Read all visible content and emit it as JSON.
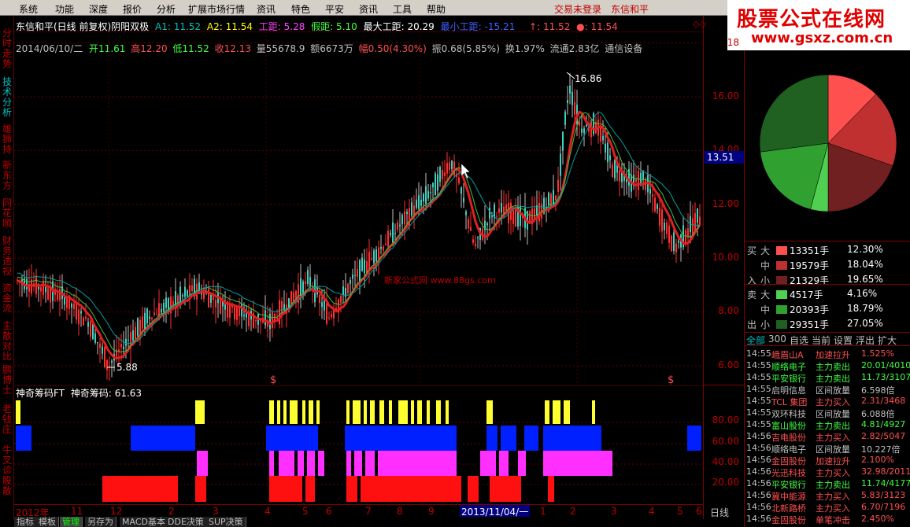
{
  "menu": {
    "items": [
      "系统",
      "功能",
      "深度",
      "报价",
      "分析",
      "扩展市场行情",
      "资讯",
      "特色",
      "平安",
      "资讯",
      "工具",
      "帮助"
    ],
    "login_status": "交易未登录",
    "stock_name": "东信和平"
  },
  "watermark": {
    "title": "股票公式在线网",
    "url": "www.gsxz.com.cn"
  },
  "left_tabs": [
    {
      "label": "分时走势",
      "active": false
    },
    {
      "label": "技术分析",
      "active": true
    },
    {
      "label": "雄狮持",
      "active": false
    },
    {
      "label": "新东方",
      "active": false
    },
    {
      "label": "同花顺",
      "active": false
    },
    {
      "label": "财务透视",
      "active": false
    },
    {
      "label": "资金流",
      "active": false
    },
    {
      "label": "主散对比",
      "active": false
    },
    {
      "label": "鹏博士",
      "active": false
    },
    {
      "label": "老钱庄",
      "active": false
    },
    {
      "label": "牛叉诊股",
      "active": false
    },
    {
      "label": "散",
      "active": false
    }
  ],
  "indicator_header": {
    "title": "东信和平(日线 前复权)阴阳双极",
    "a1": "A1: 11.52",
    "a2": "A2: 11.54",
    "gongju": "工距: 5.28",
    "jiaju": "假距: 5.10",
    "maxgongju": "最大工距: 20.29",
    "mingongju": "最小工距: -15.21",
    "v1": "↑: 11.52",
    "v2": "●: 11.54",
    "colors": {
      "a1": "#00c0c0",
      "gongju": "#ff40ff",
      "jiaju": "#40ff40",
      "min": "#4060ff",
      "white": "#ffffff"
    }
  },
  "ohlc_line": {
    "date": "2014/06/10/二",
    "open": "开11.61",
    "high": "高12.20",
    "low": "低11.52",
    "close": "收12.13",
    "volume": "量55678.9",
    "amount": "额6673万",
    "change": "幅0.50(4.30%)",
    "amplitude": "振0.68(5.85%)",
    "turnover": "换1.97%",
    "float": "流通2.83亿",
    "sector": "通信设备"
  },
  "main_chart": {
    "high_label": "16.86",
    "low_label": "5.88",
    "watermark": "新家公式网 www.88gs.com",
    "y_ticks": [
      "18",
      "16.00",
      "14.00",
      "12.00",
      "10.00",
      "8.00",
      "6.00"
    ],
    "current_price": "13.51"
  },
  "sub_chart": {
    "title": "神奇筹码FT",
    "value": "神奇筹码: 61.63",
    "y_ticks": [
      "80.00",
      "60.00",
      "40.00",
      "20.00"
    ]
  },
  "date_axis": {
    "labels": [
      "2012年",
      "11",
      "12",
      "2",
      "3",
      "4",
      "5",
      "6",
      "7",
      "8",
      "9",
      "10",
      "1",
      "2",
      "3",
      "4",
      "5",
      "6"
    ],
    "highlight": "2013/11/04/一",
    "period": "日线"
  },
  "bottom_tabs": [
    "指标",
    "模板",
    "管理",
    "另存为",
    "MACD基本",
    "DDE决策",
    "SUP决策"
  ],
  "capital_flow": {
    "buy_label": [
      "买",
      "入"
    ],
    "sell_label": [
      "卖",
      "出"
    ],
    "rows": [
      {
        "side": "买",
        "size": "大",
        "volume": "13351手",
        "pct": "12.30%",
        "color": "#ff5050"
      },
      {
        "side": "",
        "size": "中",
        "volume": "19579手",
        "pct": "18.04%",
        "color": "#c03030"
      },
      {
        "side": "入",
        "size": "小",
        "volume": "21329手",
        "pct": "19.65%",
        "color": "#702020"
      },
      {
        "side": "卖",
        "size": "大",
        "volume": "4517手",
        "pct": "4.16%",
        "color": "#50d050"
      },
      {
        "side": "",
        "size": "中",
        "volume": "20393手",
        "pct": "18.79%",
        "color": "#30a030"
      },
      {
        "side": "出",
        "size": "小",
        "volume": "29351手",
        "pct": "27.05%",
        "color": "#206020"
      }
    ]
  },
  "panel_tabs": [
    "全部",
    "300",
    "自选",
    "当前",
    "设置",
    "浮出",
    "扩大"
  ],
  "ticker": [
    {
      "time": "14:55",
      "name": "峨眉山A",
      "event": "加速拉升",
      "value": "1.525%",
      "color": "#ff5050"
    },
    {
      "time": "14:55",
      "name": "顺络电子",
      "event": "主力卖出",
      "value": "20.01/4010",
      "color": "#40ff40"
    },
    {
      "time": "14:55",
      "name": "平安银行",
      "event": "主力卖出",
      "value": "11.73/3107",
      "color": "#40ff40"
    },
    {
      "time": "14:55",
      "name": "启明信息",
      "event": "区间放量",
      "value": "6.598倍",
      "color": "#c0c0c0"
    },
    {
      "time": "14:55",
      "name": "TCL 集团",
      "event": "主力买入",
      "value": "2.31/3468",
      "color": "#ff5050"
    },
    {
      "time": "14:55",
      "name": "双环科技",
      "event": "区间放量",
      "value": "6.088倍",
      "color": "#c0c0c0"
    },
    {
      "time": "14:55",
      "name": "富山股份",
      "event": "主力卖出",
      "value": "4.81/4927",
      "color": "#40ff40"
    },
    {
      "time": "14:56",
      "name": "吉电股份",
      "event": "主力买入",
      "value": "2.82/5047",
      "color": "#ff5050"
    },
    {
      "time": "14:56",
      "name": "顺络电子",
      "event": "区间放量",
      "value": "10.227倍",
      "color": "#c0c0c0"
    },
    {
      "time": "14:56",
      "name": "金固股份",
      "event": "加速拉升",
      "value": "2.100%",
      "color": "#ff5050"
    },
    {
      "time": "14:56",
      "name": "光迅科技",
      "event": "主力买入",
      "value": "32.98/2011",
      "color": "#ff5050"
    },
    {
      "time": "14:56",
      "name": "平安银行",
      "event": "主力卖出",
      "value": "11.74/4177",
      "color": "#40ff40"
    },
    {
      "time": "14:56",
      "name": "冀中能源",
      "event": "主力买入",
      "value": "5.83/3123",
      "color": "#ff5050"
    },
    {
      "time": "14:56",
      "name": "北新路桥",
      "event": "主力买入",
      "value": "6.70/7196",
      "color": "#ff5050"
    },
    {
      "time": "14:56",
      "name": "金固股份",
      "event": "单笔冲击",
      "value": "2.450%",
      "color": "#ff5050"
    }
  ]
}
